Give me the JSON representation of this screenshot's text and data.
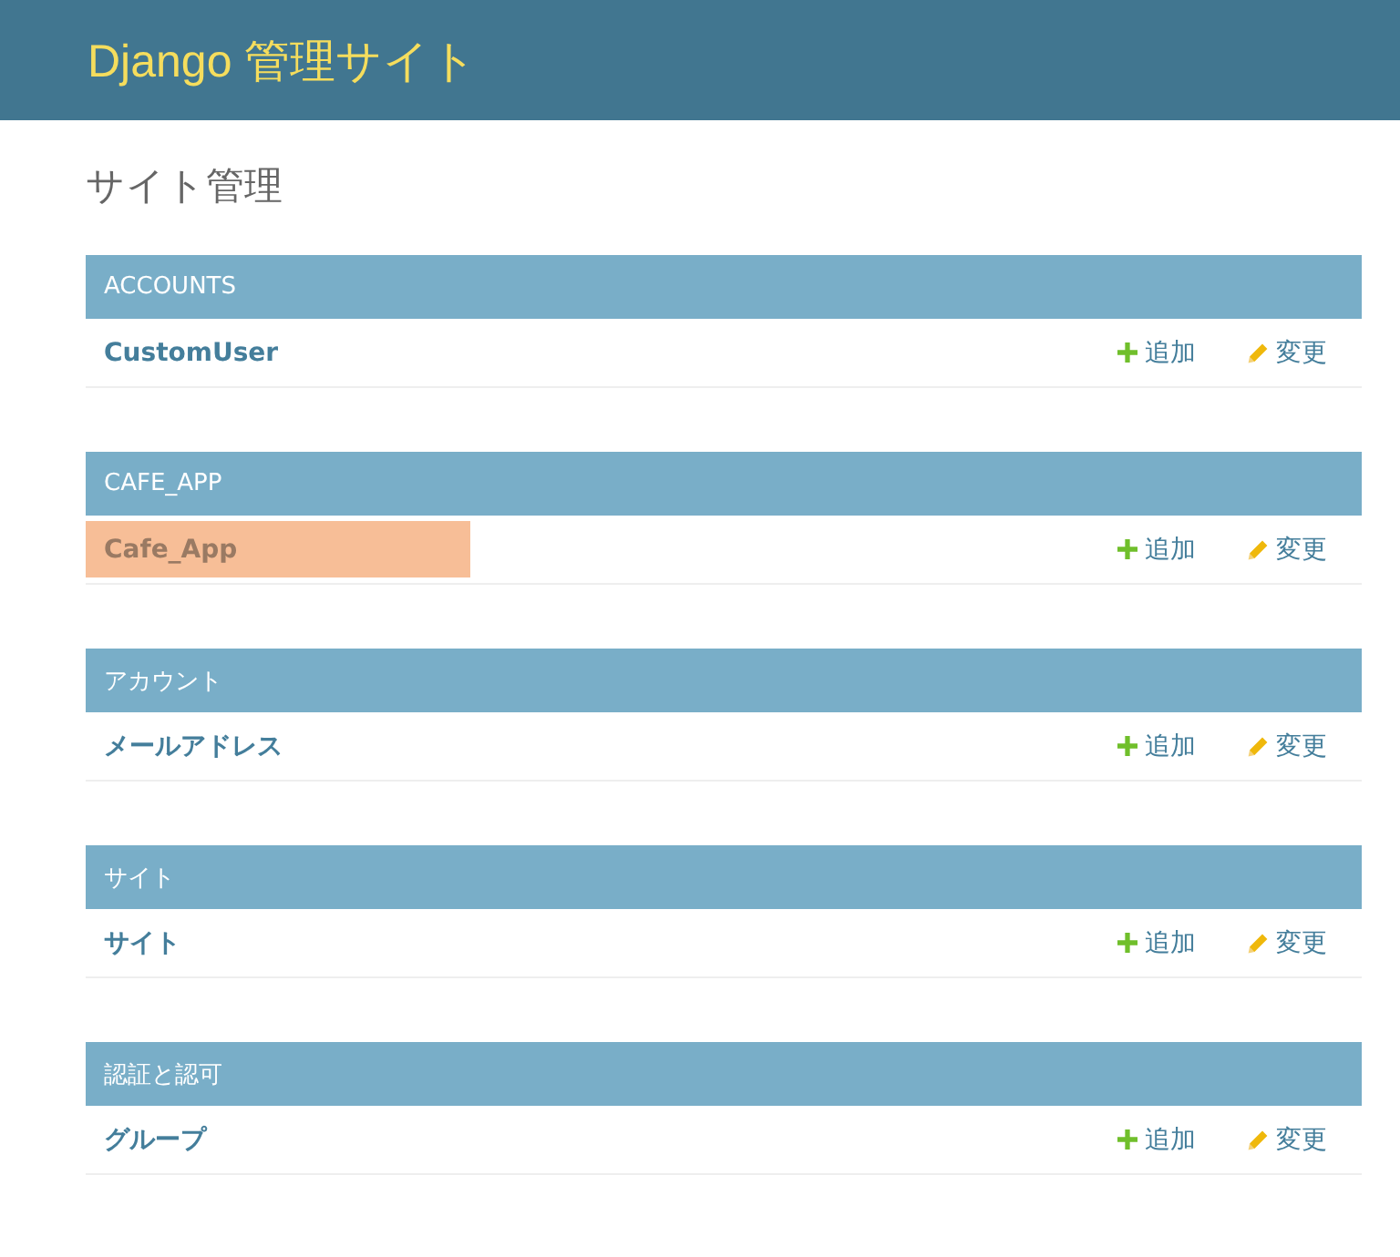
{
  "header": {
    "title": "Django 管理サイト"
  },
  "page_title": "サイト管理",
  "apps": [
    {
      "caption": "ACCOUNTS",
      "models": [
        {
          "name": "CustomUser",
          "highlighted": false,
          "add": "追加",
          "change": "変更"
        }
      ]
    },
    {
      "caption": "CAFE_APP",
      "models": [
        {
          "name": "Cafe_App",
          "highlighted": true,
          "add": "追加",
          "change": "変更"
        }
      ]
    },
    {
      "caption": "アカウント",
      "models": [
        {
          "name": "メールアドレス",
          "highlighted": false,
          "add": "追加",
          "change": "変更"
        }
      ]
    },
    {
      "caption": "サイト",
      "models": [
        {
          "name": "サイト",
          "highlighted": false,
          "add": "追加",
          "change": "変更"
        }
      ]
    },
    {
      "caption": "認証と認可",
      "models": [
        {
          "name": "グループ",
          "highlighted": false,
          "add": "追加",
          "change": "変更"
        }
      ]
    }
  ]
}
